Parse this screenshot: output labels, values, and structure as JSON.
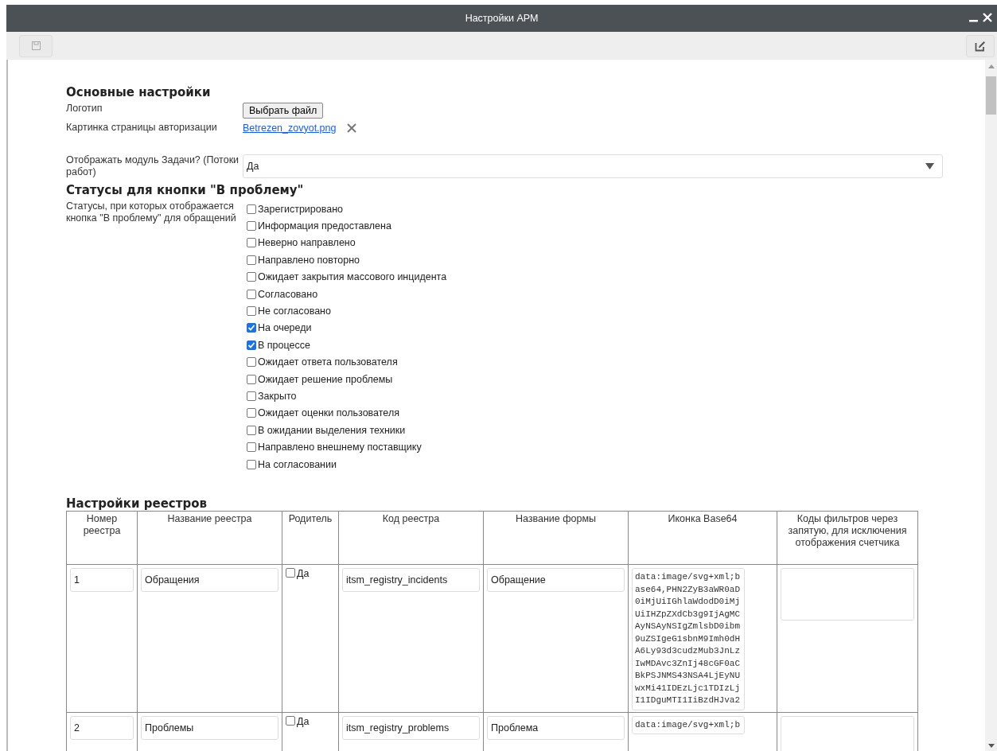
{
  "window": {
    "title": "Настройки АРМ"
  },
  "main_settings": {
    "heading": "Основные настройки",
    "logo": {
      "label": "Логотип",
      "button": "Выбрать файл"
    },
    "auth_picture": {
      "label": "Картинка страницы авторизации",
      "file_link": "Betrezen_zovyot.png"
    },
    "tasks_module": {
      "label": "Отображать модуль Задачи? (Потоки работ)",
      "value": "Да"
    }
  },
  "problem_statuses": {
    "heading": "Статусы для кнопки \"В проблему\"",
    "label": "Статусы, при которых отображается кнопка \"В проблему\" для обращений",
    "statuses": [
      {
        "label": "Зарегистрировано",
        "checked": false
      },
      {
        "label": "Информация предоставлена",
        "checked": false
      },
      {
        "label": "Неверно направлено",
        "checked": false
      },
      {
        "label": "Направлено повторно",
        "checked": false
      },
      {
        "label": "Ожидает закрытия массового инцидента",
        "checked": false
      },
      {
        "label": "Согласовано",
        "checked": false
      },
      {
        "label": "Не согласовано",
        "checked": false
      },
      {
        "label": "На очереди",
        "checked": true
      },
      {
        "label": "В процессе",
        "checked": true
      },
      {
        "label": "Ожидает ответа пользователя",
        "checked": false
      },
      {
        "label": "Ожидает решение проблемы",
        "checked": false
      },
      {
        "label": "Закрыто",
        "checked": false
      },
      {
        "label": "Ожидает оценки пользователя",
        "checked": false
      },
      {
        "label": "В ожидании выделения техники",
        "checked": false
      },
      {
        "label": "Направлено внешнему поставщику",
        "checked": false
      },
      {
        "label": "На согласовании",
        "checked": false
      }
    ]
  },
  "registries": {
    "heading": "Настройки реестров",
    "columns": [
      "Номер реестра",
      "Название реестра",
      "Родитель",
      "Код реестра",
      "Название формы",
      "Иконка Base64",
      "Коды фильтров через запятую, для исключения отображения счетчика"
    ],
    "rows": [
      {
        "number": "1",
        "name": "Обращения",
        "parent_label": "Да",
        "parent_checked": false,
        "code": "itsm_registry_incidents",
        "form_name": "Обращение",
        "icon_base64": "data:image/svg+xml;base64,PHN2ZyB3aWR0aD0iMjUiIGhlaWdodD0iMjUiIHZpZXdCb3g9IjAgMCAyNSAyNSIgZmlsbD0ibm9uZSIgeG1sbnM9Imh0dHA6Ly93d3cudzMub3JnLzIwMDAvc3ZnIj48cGF0aCBkPSJNMS43NSA4LjEyNUwxMi41IDEzLjc1TDIzLjI1IDguMTI1IiBzdHJva2"
      },
      {
        "number": "2",
        "name": "Проблемы",
        "parent_label": "Да",
        "parent_checked": false,
        "code": "itsm_registry_problems",
        "form_name": "Проблема",
        "icon_base64": "data:image/svg+xml;b"
      }
    ]
  }
}
